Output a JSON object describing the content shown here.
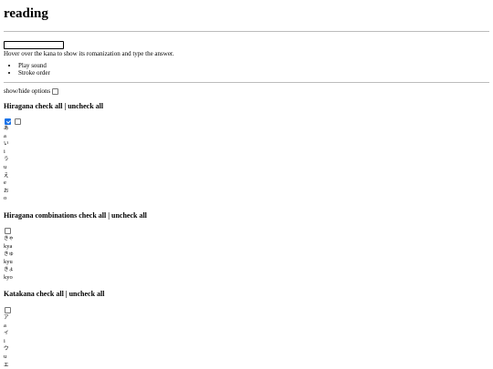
{
  "page": {
    "title": "reading"
  },
  "quiz": {
    "answer_value": "",
    "instruction": "Hover over the kana to show its romanization and type the answer.",
    "menu": [
      "Play sound",
      "Stroke order"
    ]
  },
  "options_toggle": {
    "label": "show/hide options",
    "checked": false
  },
  "sections": {
    "hiragana": {
      "name": "Hiragana",
      "check_all": "check all",
      "separator": "|",
      "uncheck_all": "uncheck all",
      "items": [
        {
          "kana": "あ",
          "romaji": "a"
        },
        {
          "kana": "い",
          "romaji": "i"
        },
        {
          "kana": "う",
          "romaji": "u"
        },
        {
          "kana": "え",
          "romaji": "e"
        },
        {
          "kana": "お",
          "romaji": "o"
        }
      ]
    },
    "hiragana_combinations": {
      "name": "Hiragana combinations",
      "check_all": "check all",
      "separator": "|",
      "uncheck_all": "uncheck all",
      "items": [
        {
          "kana": "きゃ",
          "romaji": "kya"
        },
        {
          "kana": "きゅ",
          "romaji": "kyu"
        },
        {
          "kana": "きょ",
          "romaji": "kyo"
        }
      ]
    },
    "katakana": {
      "name": "Katakana",
      "check_all": "check all",
      "separator": "|",
      "uncheck_all": "uncheck all",
      "items": [
        {
          "kana": "ア",
          "romaji": "a"
        },
        {
          "kana": "イ",
          "romaji": "i"
        },
        {
          "kana": "ウ",
          "romaji": "u"
        },
        {
          "kana": "エ",
          "romaji": ""
        }
      ]
    }
  }
}
